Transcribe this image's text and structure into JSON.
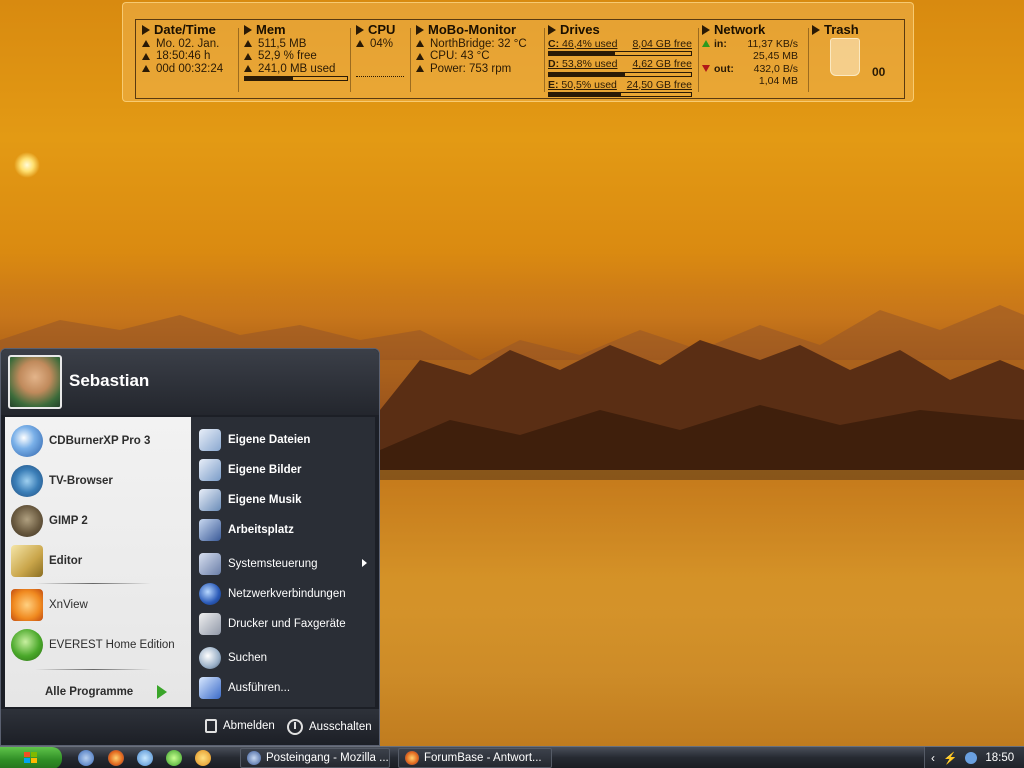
{
  "monitor": {
    "datetime": {
      "title": "Date/Time",
      "date": "Mo. 02. Jan.",
      "time": "18:50:46 h",
      "uptime": "00d 00:32:24"
    },
    "mem": {
      "title": "Mem",
      "total": "511,5 MB",
      "free": "52,9 % free",
      "used": "241,0 MB used",
      "used_fraction": 0.47
    },
    "cpu": {
      "title": "CPU",
      "value": "04%"
    },
    "mobo": {
      "title": "MoBo-Monitor",
      "northbridge": "NorthBridge: 32 °C",
      "cpu": "CPU: 43 °C",
      "power": "Power: 753 rpm"
    },
    "drives": {
      "title": "Drives",
      "items": [
        {
          "letter": "C:",
          "used": "46,4% used",
          "free": "8,04 GB free",
          "used_fraction": 0.464
        },
        {
          "letter": "D:",
          "used": "53,8% used",
          "free": "4,62 GB free",
          "used_fraction": 0.538
        },
        {
          "letter": "E:",
          "used": "50,5% used",
          "free": "24,50 GB free",
          "used_fraction": 0.505
        }
      ]
    },
    "network": {
      "title": "Network",
      "in_label": "in:",
      "in_rate": "11,37 KB/s",
      "in_total": "25,45 MB",
      "out_label": "out:",
      "out_rate": "432,0 B/s",
      "out_total": "1,04 MB"
    },
    "trash": {
      "title": "Trash",
      "count": "00"
    }
  },
  "startmenu": {
    "username": "Sebastian",
    "pinned": [
      {
        "label": "CDBurnerXP Pro 3",
        "icon": "cdburner-icon"
      },
      {
        "label": "TV-Browser",
        "icon": "tvbrowser-icon"
      },
      {
        "label": "GIMP 2",
        "icon": "gimp-icon"
      },
      {
        "label": "Editor",
        "icon": "notepad-icon"
      }
    ],
    "recent": [
      {
        "label": "XnView",
        "icon": "xnview-icon"
      },
      {
        "label": "EVEREST Home Edition",
        "icon": "everest-icon"
      }
    ],
    "all_programs": "Alle Programme",
    "places": [
      {
        "label": "Eigene Dateien",
        "icon": "documents-icon"
      },
      {
        "label": "Eigene Bilder",
        "icon": "pictures-icon"
      },
      {
        "label": "Eigene Musik",
        "icon": "music-icon"
      },
      {
        "label": "Arbeitsplatz",
        "icon": "computer-icon"
      }
    ],
    "system": [
      {
        "label": "Systemsteuerung",
        "icon": "control-panel-icon"
      },
      {
        "label": "Netzwerkverbindungen",
        "icon": "network-connections-icon"
      },
      {
        "label": "Drucker und Faxgeräte",
        "icon": "printer-icon"
      },
      {
        "label": "Suchen",
        "icon": "search-icon"
      },
      {
        "label": "Ausführen...",
        "icon": "run-icon"
      }
    ],
    "logoff": "Abmelden",
    "shutdown": "Ausschalten"
  },
  "taskbar": {
    "tasks": [
      {
        "label": "Posteingang - Mozilla ...",
        "icon": "thunderbird-icon"
      },
      {
        "label": "ForumBase - Antwort...",
        "icon": "firefox-icon"
      }
    ],
    "clock": "18:50"
  },
  "colors": {
    "accent_green": "#3aa52a",
    "menu_dark": "#2a2e36",
    "wallpaper_orange": "#e39a14"
  }
}
